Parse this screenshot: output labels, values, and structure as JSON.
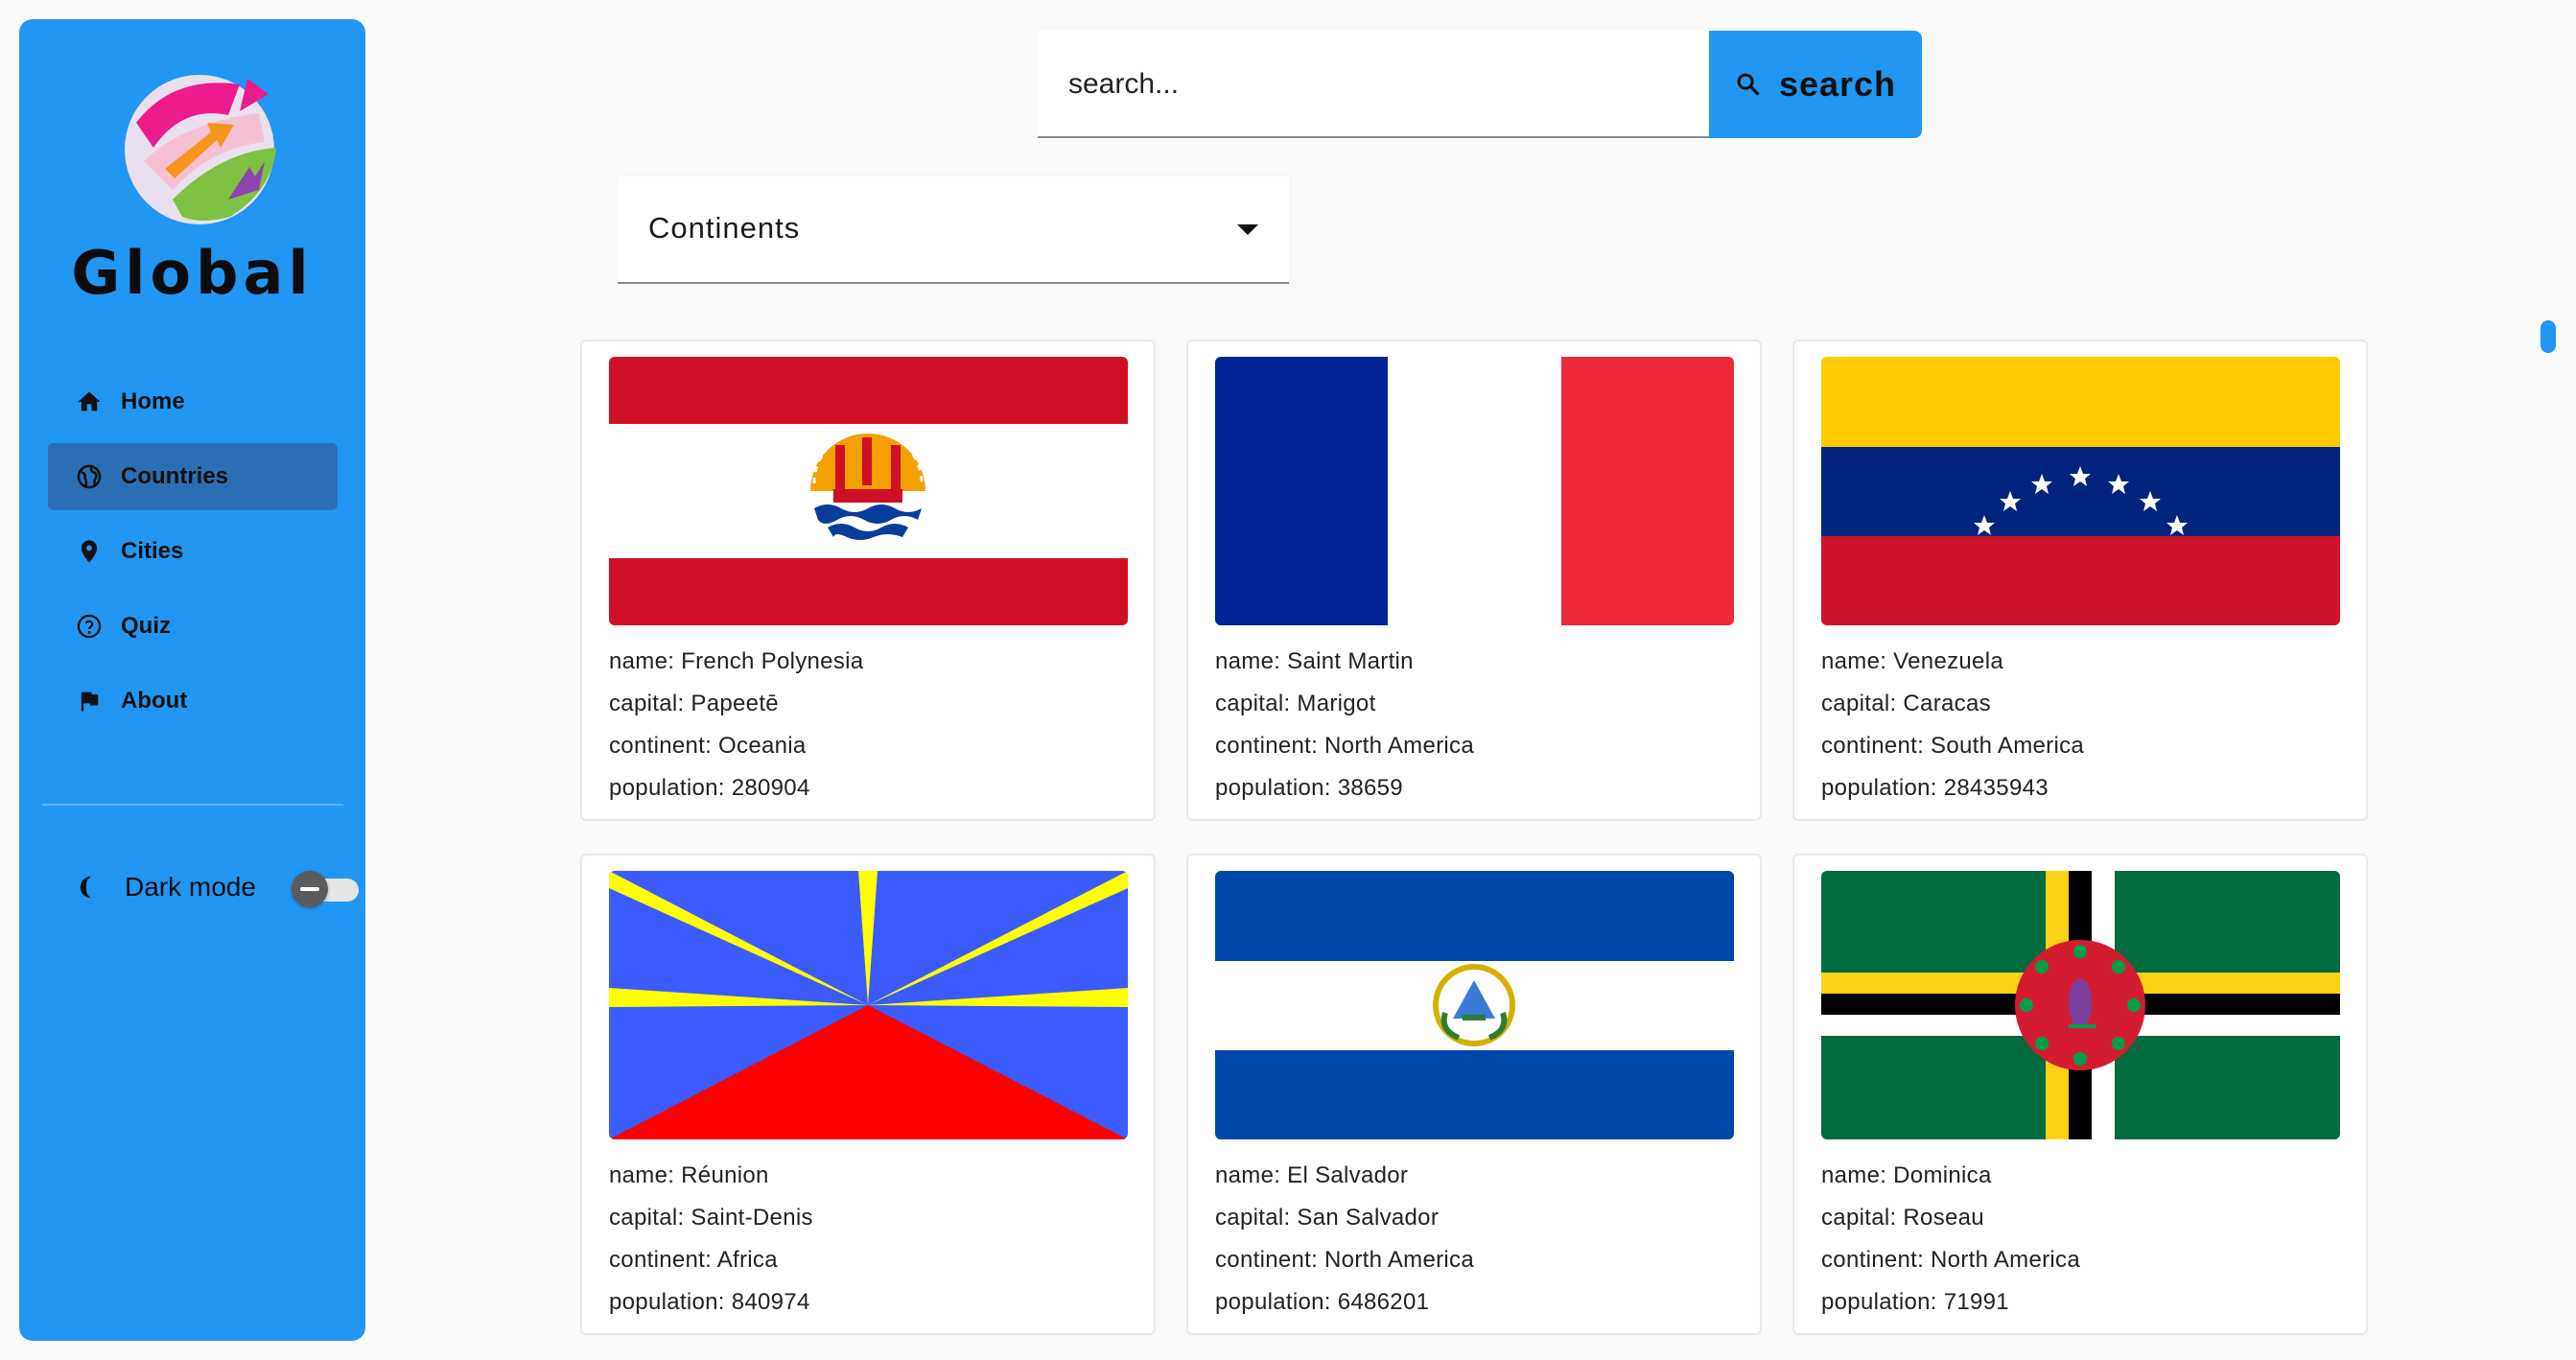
{
  "app": {
    "name": "Global",
    "accent_color": "#2196f3",
    "logo_icon": "globe-arrows-icon"
  },
  "sidebar": {
    "items": [
      {
        "label": "Home",
        "icon": "home-icon",
        "active": false
      },
      {
        "label": "Countries",
        "icon": "globe-icon",
        "active": true
      },
      {
        "label": "Cities",
        "icon": "location-pin-icon",
        "active": false
      },
      {
        "label": "Quiz",
        "icon": "help-circle-icon",
        "active": false
      },
      {
        "label": "About",
        "icon": "flag-icon",
        "active": false
      }
    ],
    "dark_mode": {
      "label": "Dark mode",
      "enabled": false
    }
  },
  "search": {
    "placeholder": "search...",
    "button_label": "search"
  },
  "filter": {
    "label": "Continents"
  },
  "field_labels": {
    "name": "name: ",
    "capital": "capital: ",
    "continent": "continent: ",
    "population": "population: "
  },
  "countries": [
    {
      "name": "French Polynesia",
      "capital": "Papeetē",
      "continent": "Oceania",
      "population": "280904",
      "flag": "french-polynesia-flag"
    },
    {
      "name": "Saint Martin",
      "capital": "Marigot",
      "continent": "North America",
      "population": "38659",
      "flag": "saint-martin-flag"
    },
    {
      "name": "Venezuela",
      "capital": "Caracas",
      "continent": "South America",
      "population": "28435943",
      "flag": "venezuela-flag"
    },
    {
      "name": "Réunion",
      "capital": "Saint-Denis",
      "continent": "Africa",
      "population": "840974",
      "flag": "reunion-flag"
    },
    {
      "name": "El Salvador",
      "capital": "San Salvador",
      "continent": "North America",
      "population": "6486201",
      "flag": "el-salvador-flag"
    },
    {
      "name": "Dominica",
      "capital": "Roseau",
      "continent": "North America",
      "population": "71991",
      "flag": "dominica-flag"
    }
  ]
}
